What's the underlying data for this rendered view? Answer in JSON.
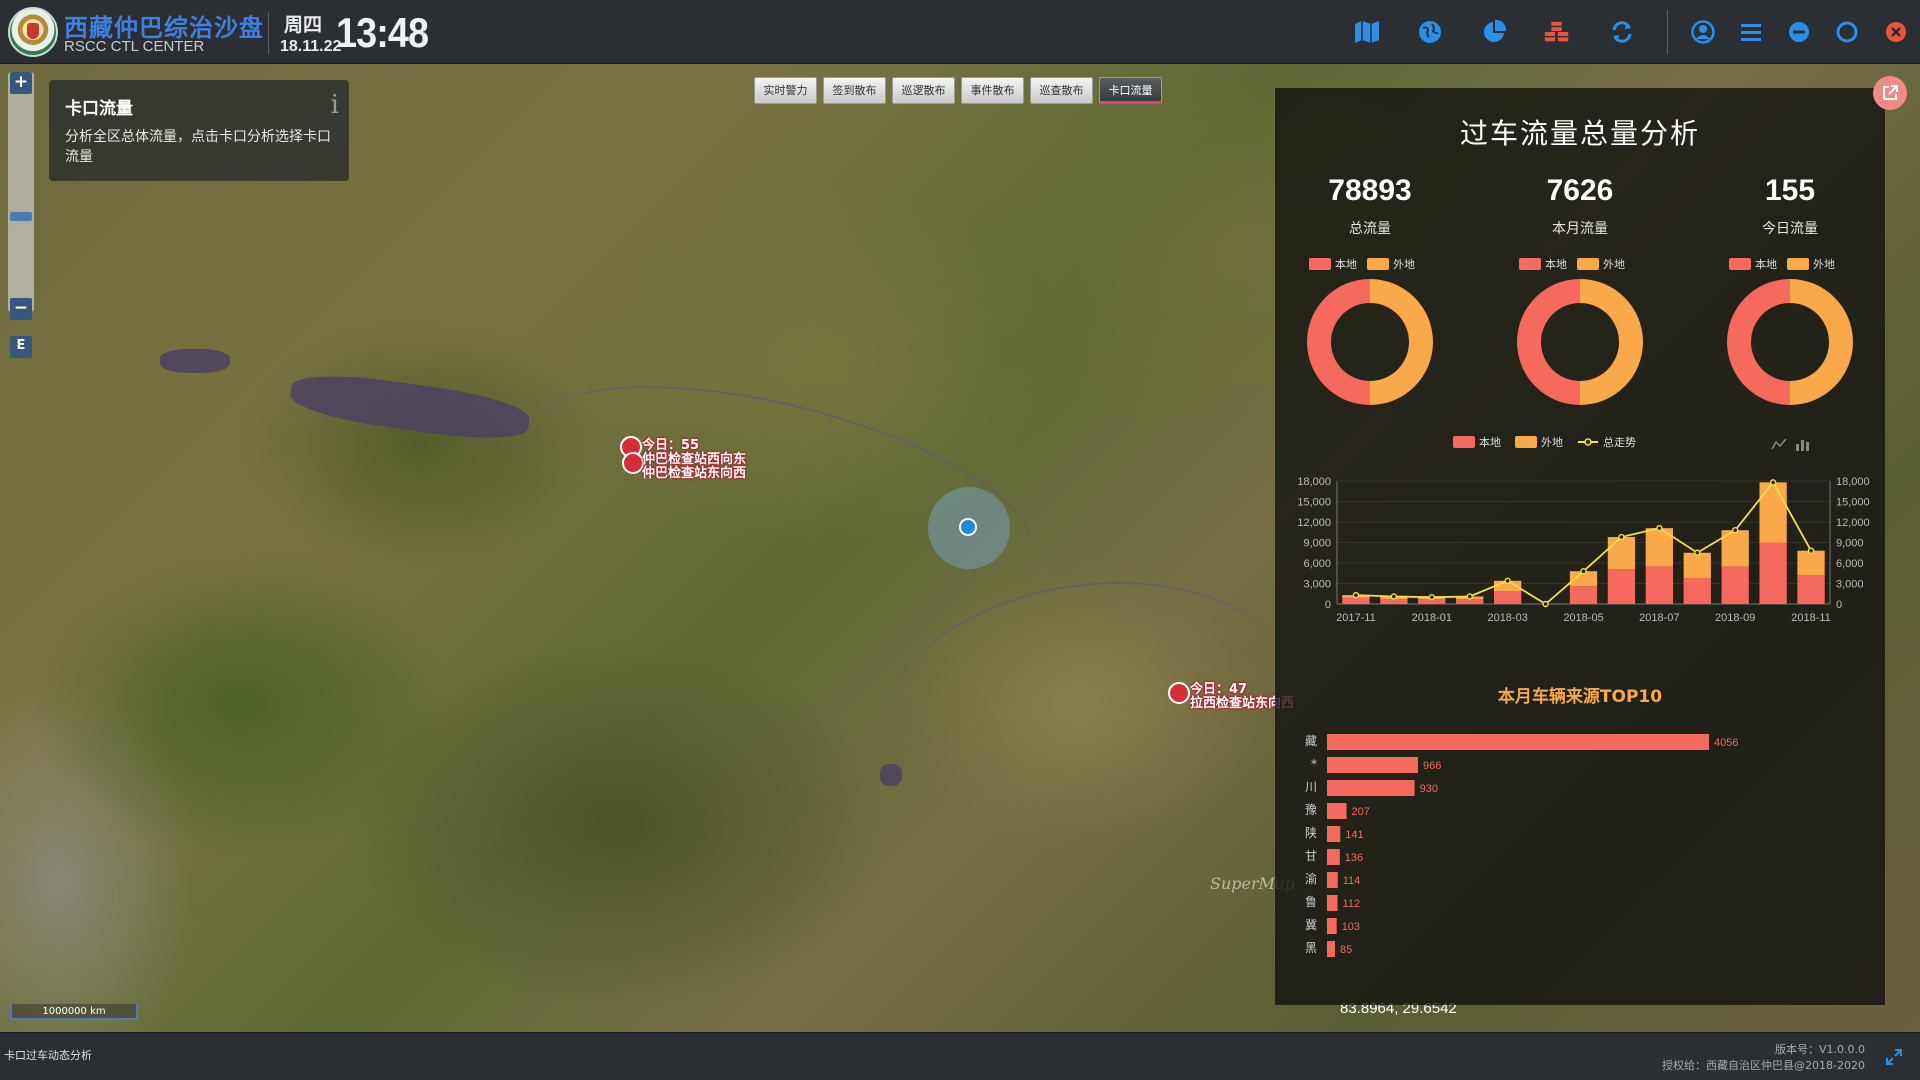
{
  "header": {
    "title": "西藏仲巴综治沙盘",
    "subtitle": "RSCC CTL CENTER",
    "weekday": "周四",
    "date": "18.11.22",
    "time": "13:48",
    "icons": [
      "map-icon",
      "globe-icon",
      "pie-chart-icon",
      "layers-cubes-icon",
      "refresh-icon",
      "user-icon",
      "menu-icon",
      "minimize-icon",
      "maximize-icon",
      "close-icon"
    ]
  },
  "info_card": {
    "title": "卡口流量",
    "description": "分析全区总体流量，点击卡口分析选择卡口流量",
    "icon": "info-icon"
  },
  "tabs": [
    {
      "label": "实时警力"
    },
    {
      "label": "签到散布"
    },
    {
      "label": "巡逻散布"
    },
    {
      "label": "事件散布"
    },
    {
      "label": "巡查散布"
    },
    {
      "label": "卡口流量",
      "active": true
    }
  ],
  "map": {
    "markers": [
      {
        "line1": "今日：55",
        "line2": "仲巴检查站西向东",
        "line3": "仲巴检查站东向西"
      },
      {
        "line1": "今日：47",
        "line2": "拉西检查站东向西"
      }
    ],
    "watermark": "SuperMap",
    "scale": "1000000 km",
    "coords": "83.8964, 29.6542"
  },
  "panel": {
    "title": "过车流量总量分析",
    "stats": [
      {
        "value": "78893",
        "label": "总流量"
      },
      {
        "value": "7626",
        "label": "本月流量"
      },
      {
        "value": "155",
        "label": "今日流量"
      }
    ],
    "legend_local": "本地",
    "legend_other": "外地",
    "legend_trend": "总走势",
    "colors": {
      "local": "#f56a5c",
      "other": "#f9a84a",
      "trend": "#f5e044"
    }
  },
  "chart_data": [
    {
      "type": "pie",
      "title": "总流量",
      "labels": [
        "本地",
        "外地"
      ],
      "values": [
        50,
        50
      ]
    },
    {
      "type": "pie",
      "title": "本月流量",
      "labels": [
        "本地",
        "外地"
      ],
      "values": [
        50,
        50
      ]
    },
    {
      "type": "pie",
      "title": "今日流量",
      "labels": [
        "本地",
        "外地"
      ],
      "values": [
        50,
        50
      ]
    },
    {
      "type": "bar",
      "stacked": true,
      "categories": [
        "2017-11",
        "2017-12",
        "2018-01",
        "2018-02",
        "2018-03",
        "2018-04",
        "2018-05",
        "2018-06",
        "2018-07",
        "2018-08",
        "2018-09",
        "2018-10",
        "2018-11"
      ],
      "tick_labels_x": [
        "2017-11",
        "2018-01",
        "2018-03",
        "2018-05",
        "2018-07",
        "2018-09",
        "2018-11"
      ],
      "series": [
        {
          "name": "本地",
          "values": [
            900,
            700,
            700,
            700,
            1900,
            0,
            2600,
            5100,
            5500,
            3800,
            5500,
            9000,
            4200
          ]
        },
        {
          "name": "外地",
          "values": [
            400,
            400,
            300,
            400,
            1500,
            0,
            2200,
            4700,
            5600,
            3700,
            5300,
            8800,
            3600
          ]
        },
        {
          "name": "总走势",
          "type": "line",
          "values": [
            1300,
            1100,
            1000,
            1100,
            3400,
            0,
            4800,
            9800,
            11100,
            7500,
            10800,
            17800,
            7800
          ]
        }
      ],
      "ylim": [
        0,
        18000
      ],
      "yticks": [
        "0",
        "3,000",
        "6,000",
        "9,000",
        "12,000",
        "15,000",
        "18,000"
      ]
    },
    {
      "type": "bar",
      "orientation": "horizontal",
      "title": "本月车辆来源TOP10",
      "categories": [
        "藏",
        "*",
        "川",
        "豫",
        "陕",
        "甘",
        "渝",
        "鲁",
        "冀",
        "黑"
      ],
      "values": [
        4056,
        966,
        930,
        207,
        141,
        136,
        114,
        112,
        103,
        85
      ]
    }
  ],
  "footer": {
    "left": "卡口过车动态分析",
    "version": "版本号：V1.0.0.0",
    "license": "授权给：西藏自治区仲巴县@2018-2020"
  }
}
